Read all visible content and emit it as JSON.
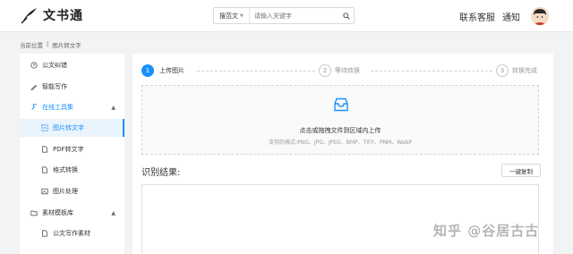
{
  "header": {
    "logo_text": "文书通",
    "search_type": "搜范文",
    "search_placeholder": "请输入关键字",
    "nav_service": "联系客服",
    "nav_notice": "通知"
  },
  "breadcrumb": {
    "current_label": "当前位置",
    "separator": "|",
    "page": "图片转文字"
  },
  "sidebar": {
    "items": [
      {
        "label": "公文纠错"
      },
      {
        "label": "智能写作"
      },
      {
        "label": "在线工具集"
      },
      {
        "label": "图片转文字"
      },
      {
        "label": "PDF转文字"
      },
      {
        "label": "格式转换"
      },
      {
        "label": "图片处理"
      },
      {
        "label": "素材模板库"
      },
      {
        "label": "公文写作素材"
      }
    ]
  },
  "steps": [
    {
      "num": "1",
      "label": "上传图片"
    },
    {
      "num": "2",
      "label": "等待转换"
    },
    {
      "num": "3",
      "label": "转换完成"
    }
  ],
  "upload": {
    "main_text": "点击或拖拽文件到区域内上传",
    "sub_text": "支持的格式:PNG、JPG、JPEG、BMP、TIFF、PNM、WebP"
  },
  "result": {
    "title": "识别结果:",
    "copy_label": "一键复制"
  },
  "watermark": "知乎 @谷居古古",
  "colors": {
    "accent": "#1890ff",
    "background": "#f2f3f5"
  }
}
